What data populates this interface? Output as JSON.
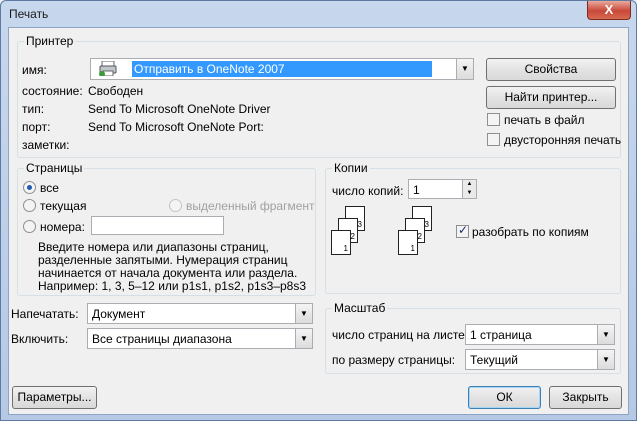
{
  "window": {
    "title": "Печать",
    "close_label": "X"
  },
  "printer": {
    "group_title": "Принтер",
    "name_label": "имя:",
    "name_value": "Отправить в OneNote 2007",
    "status_label": "состояние:",
    "status_value": "Свободен",
    "type_label": "тип:",
    "type_value": "Send To Microsoft OneNote Driver",
    "port_label": "порт:",
    "port_value": "Send To Microsoft OneNote Port:",
    "notes_label": "заметки:",
    "properties_button": "Свойства",
    "find_printer_button": "Найти принтер...",
    "print_to_file_label": "печать в файл",
    "duplex_label": "двусторонняя печать"
  },
  "pages": {
    "group_title": "Страницы",
    "all_label": "все",
    "current_label": "текущая",
    "selection_label": "выделенный фрагмент",
    "numbers_label": "номера:",
    "help_text": [
      "Введите номера или диапазоны страниц,",
      "разделенные запятыми. Нумерация страниц",
      "начинается от начала документа или раздела.",
      "Например: 1, 3, 5–12 или p1s1, p1s2, p1s3–p8s3"
    ]
  },
  "copies": {
    "group_title": "Копии",
    "count_label": "число копий:",
    "count_value": "1",
    "collate_label": "разобрать по копиям",
    "page_numbers": [
      "1",
      "2",
      "3"
    ]
  },
  "print_what": {
    "label": "Напечатать:",
    "value": "Документ"
  },
  "include": {
    "label": "Включить:",
    "value": "Все страницы диапазона"
  },
  "zoom": {
    "group_title": "Масштаб",
    "pages_per_sheet_label": "число страниц на листе:",
    "pages_per_sheet_value": "1 страница",
    "scale_label": "по размеру страницы:",
    "scale_value": "Текущий"
  },
  "footer": {
    "options_button": "Параметры...",
    "ok_button": "ОК",
    "cancel_button": "Закрыть"
  }
}
